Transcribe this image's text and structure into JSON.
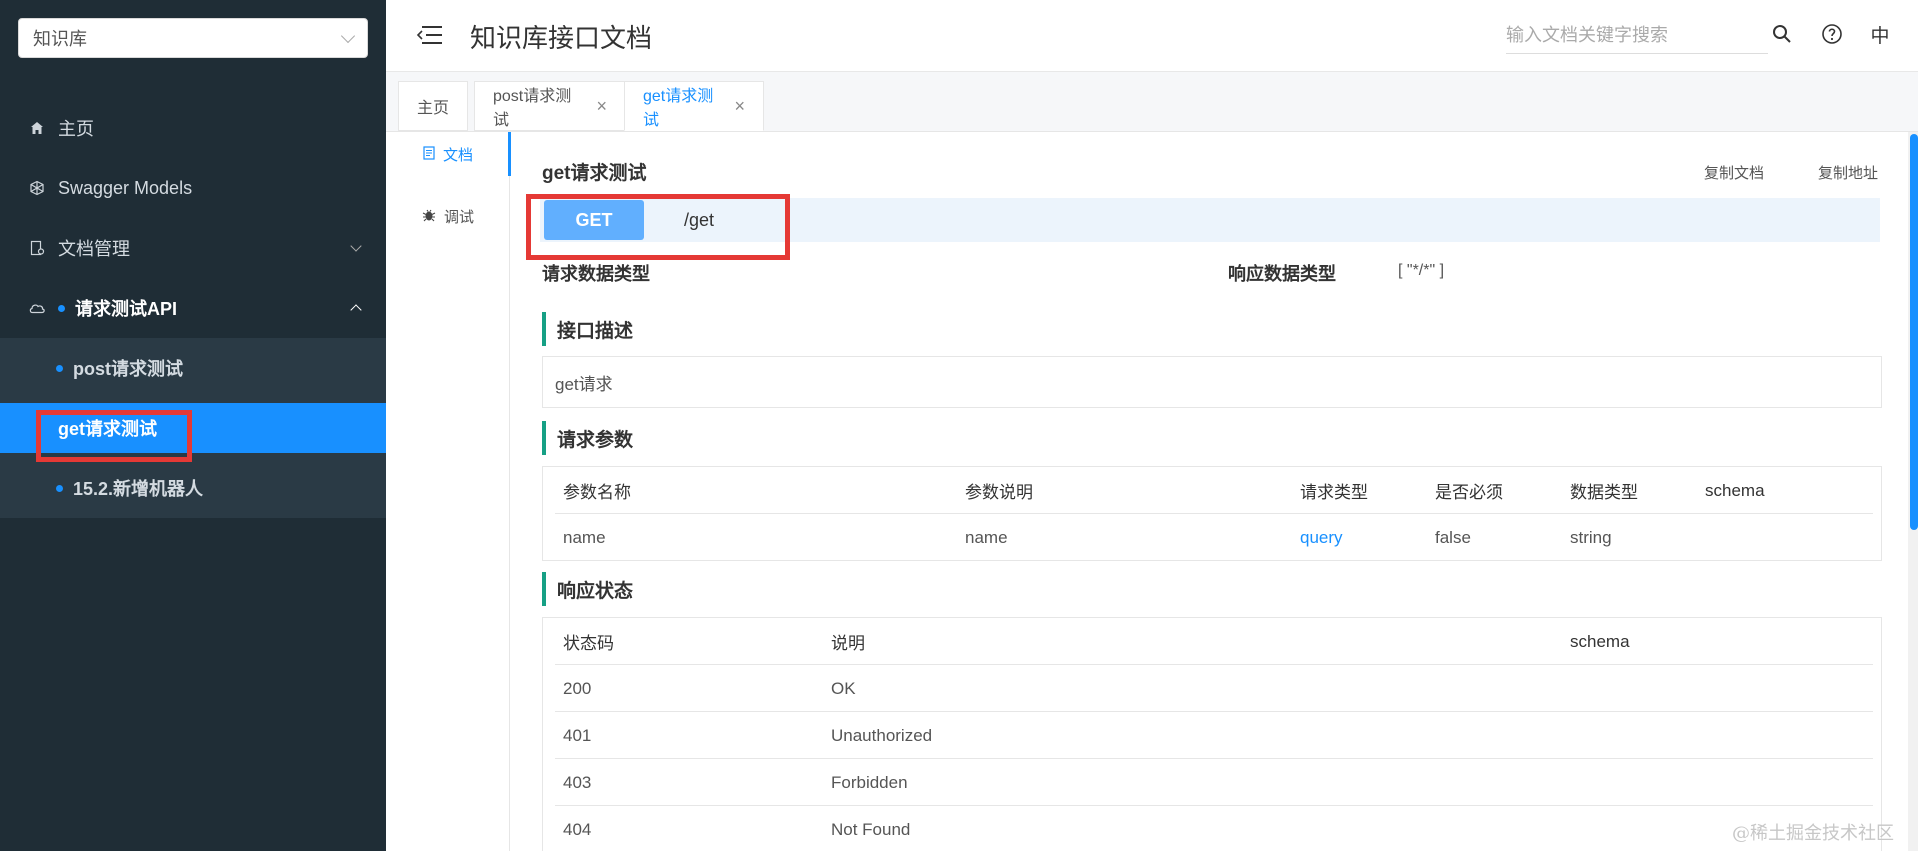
{
  "sidebar": {
    "library_select": "知识库",
    "items": [
      {
        "label": "主页"
      },
      {
        "label": "Swagger Models"
      },
      {
        "label": "文档管理"
      },
      {
        "label": "请求测试API"
      }
    ],
    "sub_items": [
      {
        "label": "post请求测试"
      },
      {
        "label": "get请求测试"
      },
      {
        "label": "15.2.新增机器人"
      }
    ]
  },
  "header": {
    "title": "知识库接口文档",
    "search_placeholder": "输入文档关键字搜索",
    "lang": "中"
  },
  "tabs": [
    {
      "label": "主页"
    },
    {
      "label": "post请求测试"
    },
    {
      "label": "get请求测试"
    }
  ],
  "left_nav": [
    {
      "label": "文档"
    },
    {
      "label": "调试"
    }
  ],
  "api": {
    "title": "get请求测试",
    "copy_doc": "复制文档",
    "copy_url": "复制地址",
    "method": "GET",
    "path": "/get",
    "request_type_label": "请求数据类型",
    "response_type_label": "响应数据类型",
    "response_type_value": "[ \"*/*\" ]",
    "desc_title": "接口描述",
    "desc": "get请求",
    "params_title": "请求参数",
    "params_headers": [
      "参数名称",
      "参数说明",
      "请求类型",
      "是否必须",
      "数据类型",
      "schema"
    ],
    "params_rows": [
      [
        "name",
        "name",
        "query",
        "false",
        "string",
        ""
      ]
    ],
    "status_title": "响应状态",
    "status_headers": [
      "状态码",
      "说明",
      "schema"
    ],
    "status_rows": [
      [
        "200",
        "OK",
        ""
      ],
      [
        "401",
        "Unauthorized",
        ""
      ],
      [
        "403",
        "Forbidden",
        ""
      ],
      [
        "404",
        "Not Found",
        ""
      ]
    ]
  },
  "watermark": "@稀土掘金技术社区",
  "colors": {
    "sidebar_bg": "#1f2d36",
    "accent": "#1890ff",
    "get_method": "#61affe",
    "section_bar": "#16a085",
    "highlight_box": "#e53935"
  }
}
